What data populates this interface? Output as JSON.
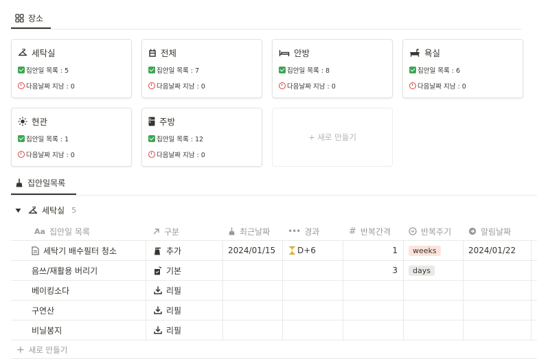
{
  "tabs": {
    "places_label": "장소",
    "tasks_label": "집안일목록"
  },
  "cards": [
    {
      "name": "세탁실",
      "icon": "hanger-icon",
      "task_count": "집안일 목록 : 5",
      "overdue": "다음날짜 지남 : 0"
    },
    {
      "name": "전체",
      "icon": "building-icon",
      "task_count": "집안일 목록 : 7",
      "overdue": "다음날짜 지남 : 0"
    },
    {
      "name": "안방",
      "icon": "bed-icon",
      "task_count": "집안일 목록 : 8",
      "overdue": "다음날짜 지남 : 0"
    },
    {
      "name": "욕실",
      "icon": "bathtub-icon",
      "task_count": "집안일 목록 : 6",
      "overdue": "다음날짜 지남 : 0"
    },
    {
      "name": "현관",
      "icon": "sun-icon",
      "task_count": "집안일 목록 : 1",
      "overdue": "다음날짜 지남 : 0"
    },
    {
      "name": "주방",
      "icon": "fridge-icon",
      "task_count": "집안일 목록 : 12",
      "overdue": "다음날짜 지남 : 0"
    }
  ],
  "new_card_label": "+ 새로 만들기",
  "group": {
    "name": "세탁실",
    "count": "5"
  },
  "table": {
    "columns": {
      "name": "집안일 목록",
      "type": "구분",
      "last_date": "최근날짜",
      "elapsed": "경과",
      "interval": "반복간격",
      "cycle": "반복주기",
      "alert_date": "알림날짜"
    },
    "rows": [
      {
        "name": "세탁기 배수필터 청소",
        "type": "추가",
        "type_icon": "spray-icon",
        "last_date": "2024/01/15",
        "elapsed": "D+6",
        "interval": "1",
        "cycle": "weeks",
        "alert_date": "2024/01/22"
      },
      {
        "name": "음쓰/재활용 버리기",
        "type": "기본",
        "type_icon": "bin-icon",
        "last_date": "",
        "elapsed": "",
        "interval": "3",
        "cycle": "days",
        "alert_date": ""
      },
      {
        "name": "베이킹소다",
        "type": "리필",
        "type_icon": "download-icon",
        "last_date": "",
        "elapsed": "",
        "interval": "",
        "cycle": "",
        "alert_date": ""
      },
      {
        "name": "구연산",
        "type": "리필",
        "type_icon": "download-icon",
        "last_date": "",
        "elapsed": "",
        "interval": "",
        "cycle": "",
        "alert_date": ""
      },
      {
        "name": "비닐봉지",
        "type": "리필",
        "type_icon": "download-icon",
        "last_date": "",
        "elapsed": "",
        "interval": "",
        "cycle": "",
        "alert_date": ""
      }
    ],
    "new_row_label": "새로 만들기"
  },
  "colors": {
    "weeks_pill_bg": "#fbe4dc",
    "days_pill_bg": "#e9e9e7",
    "check_green": "#3ea553",
    "alarm_red": "#e03e3e"
  }
}
